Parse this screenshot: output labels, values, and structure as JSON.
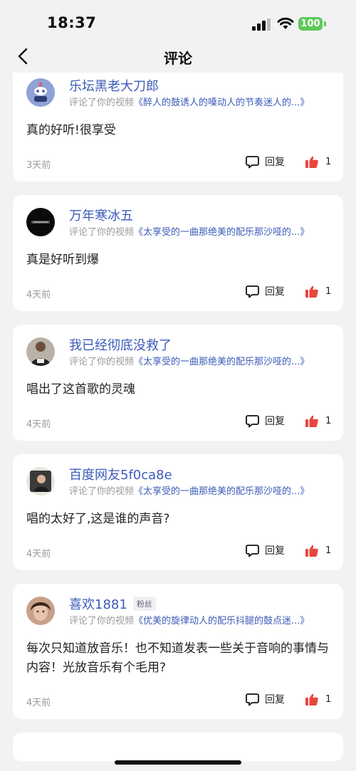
{
  "status": {
    "time": "18:37",
    "battery": "100",
    "accent_battery": "#5ec95a"
  },
  "nav": {
    "title": "评论",
    "back_icon": "chevron-left-icon"
  },
  "colors": {
    "link": "#3b5bb8",
    "like": "#e8473f",
    "background": "#f2f2f5"
  },
  "comments": [
    {
      "user": "乐坛黑老大刀郎",
      "badge": "",
      "prefix": "评论了你的视频",
      "video": "《醉人的鼓诱人的嗓动人的节奏迷人的...》",
      "text": "真的好听!很享受",
      "time": "3天前",
      "reply_label": "回复",
      "likes": "1"
    },
    {
      "user": "万年寒冰五",
      "badge": "",
      "prefix": "评论了你的视频",
      "video": "《太享受的一曲那绝美的配乐那沙哑的...》",
      "text": "真是好听到爆",
      "time": "4天前",
      "reply_label": "回复",
      "likes": "1"
    },
    {
      "user": "我已经彻底没救了",
      "badge": "",
      "prefix": "评论了你的视频",
      "video": "《太享受的一曲那绝美的配乐那沙哑的...》",
      "text": "唱出了这首歌的灵魂",
      "time": "4天前",
      "reply_label": "回复",
      "likes": "1"
    },
    {
      "user": "百度网友5f0ca8e",
      "badge": "",
      "prefix": "评论了你的视频",
      "video": "《太享受的一曲那绝美的配乐那沙哑的...》",
      "text": "唱的太好了,这是谁的声音?",
      "time": "4天前",
      "reply_label": "回复",
      "likes": "1"
    },
    {
      "user": "喜欢1881",
      "badge": "粉丝",
      "prefix": "评论了你的视频",
      "video": "《优美的旋律动人的配乐抖腿的鼓点迷...》",
      "text": "每次只知道放音乐！也不知道发表一些关于音响的事情与内容！光放音乐有个毛用?",
      "time": "4天前",
      "reply_label": "回复",
      "likes": "1"
    }
  ]
}
